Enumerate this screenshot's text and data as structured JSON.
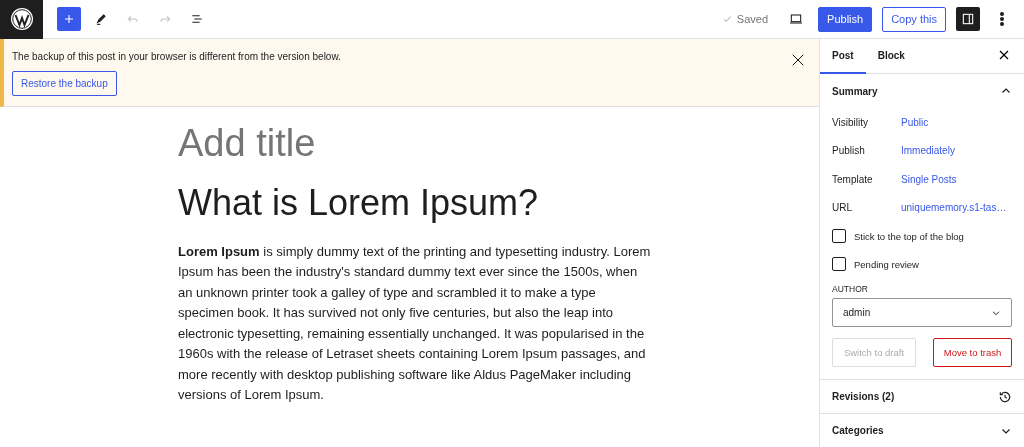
{
  "toolbar": {
    "tools": [
      {
        "kind": "add",
        "disabled": false
      },
      {
        "kind": "pen",
        "disabled": false
      },
      {
        "kind": "undo",
        "disabled": true
      },
      {
        "kind": "redo",
        "disabled": true
      },
      {
        "kind": "list",
        "disabled": false
      }
    ],
    "saved_status": "Saved",
    "publish": "Publish",
    "copy": "Copy this",
    "settings_toggle": {
      "selected": true
    }
  },
  "notice": {
    "message": "The backup of this post in your browser is different from the version below.",
    "action": "Restore the backup"
  },
  "editor": {
    "title_placeholder": "Add title",
    "heading": "What is Lorem Ipsum?",
    "paragraph": "**Lorem Ipsum** is simply dummy text of the printing and typesetting industry. Lorem Ipsum has been the industry's standard dummy text ever since the 1500s, when an unknown printer took a galley of type and scrambled it to make a type specimen book. It has survived not only five centuries, but also the leap into electronic typesetting, remaining essentially unchanged. It was popularised in the 1960s with the release of Letraset sheets containing Lorem Ipsum passages, and more recently with desktop publishing software like Aldus PageMaker including versions of Lorem Ipsum."
  },
  "sidebar": {
    "tabs": [
      {
        "label": "Post",
        "selected": true
      },
      {
        "label": "Block",
        "selected": false
      }
    ],
    "summary": {
      "title": "Summary",
      "expanded": true,
      "rows": [
        {
          "label": "Visibility",
          "value": "Public"
        },
        {
          "label": "Publish",
          "value": "Immediately"
        },
        {
          "label": "Template",
          "value": "Single Posts"
        },
        {
          "label": "URL",
          "value": "uniquememory.s1-tas…"
        }
      ],
      "checkboxes": [
        {
          "label": "Stick to the top of the blog",
          "checked": false
        },
        {
          "label": "Pending review",
          "checked": false
        }
      ],
      "author_label": "AUTHOR",
      "author_value": "admin",
      "switch_draft": {
        "label": "Switch to draft",
        "disabled": true
      },
      "trash": "Move to trash"
    },
    "panels": [
      {
        "title": "Revisions (2)",
        "kind": "history"
      },
      {
        "title": "Categories",
        "kind": "chevron",
        "expanded": false
      }
    ]
  }
}
